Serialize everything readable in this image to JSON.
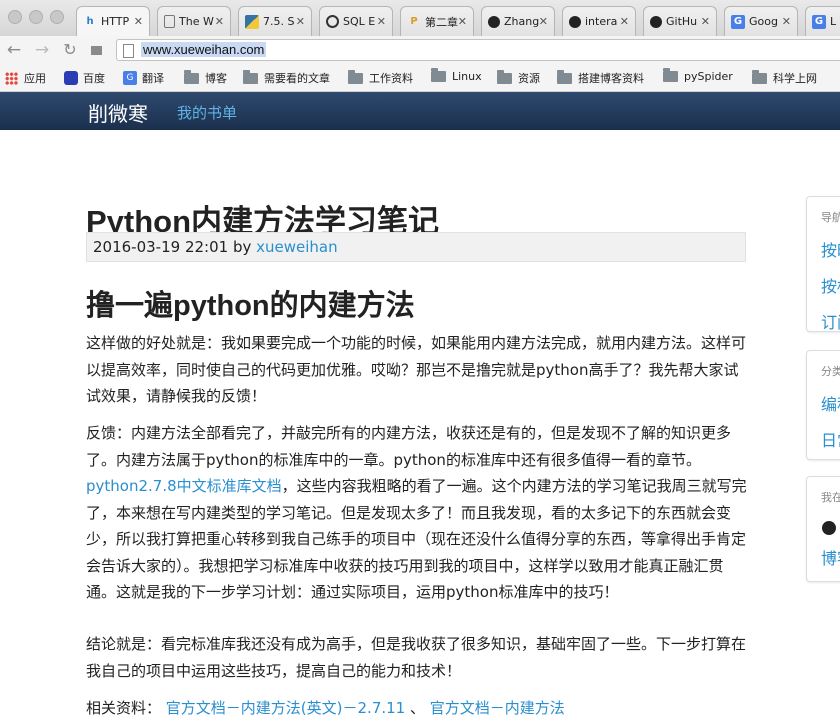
{
  "browser": {
    "tabs": [
      {
        "label": "HTTP",
        "icon": "hm-icon",
        "icon_color": "#2a7fd0"
      },
      {
        "label": "The W",
        "icon": "page-icon",
        "icon_color": "#666666"
      },
      {
        "label": "7.5. S",
        "icon": "python-icon",
        "icon_color": "#3572a5"
      },
      {
        "label": "SQL E",
        "icon": "sql-icon",
        "icon_color": "#333333"
      },
      {
        "label": "第二章",
        "icon": "p-icon",
        "icon_color": "#d6a11e"
      },
      {
        "label": "Zhang",
        "icon": "github-icon",
        "icon_color": "#222222"
      },
      {
        "label": "intera",
        "icon": "github-icon",
        "icon_color": "#222222"
      },
      {
        "label": "GitHu",
        "icon": "github-icon",
        "icon_color": "#222222"
      },
      {
        "label": "Goog",
        "icon": "google-translate-icon",
        "icon_color": "#4a7ee8"
      },
      {
        "label": "L",
        "icon": "google-translate-icon",
        "icon_color": "#4a7ee8"
      }
    ],
    "url": "www.xueweihan.com"
  },
  "bookmarks": [
    {
      "label": "应用",
      "icon": "apps-icon"
    },
    {
      "label": "百度",
      "icon": "baidu-icon"
    },
    {
      "label": "翻译",
      "icon": "translate-icon"
    },
    {
      "label": "博客",
      "icon": "folder-icon"
    },
    {
      "label": "需要看的文章",
      "icon": "folder-icon"
    },
    {
      "label": "工作资料",
      "icon": "folder-icon"
    },
    {
      "label": "Linux",
      "icon": "folder-icon"
    },
    {
      "label": "资源",
      "icon": "folder-icon"
    },
    {
      "label": "搭建博客资料",
      "icon": "folder-icon"
    },
    {
      "label": "pySpider",
      "icon": "folder-icon"
    },
    {
      "label": "科学上网",
      "icon": "folder-icon"
    }
  ],
  "site": {
    "brand": "削微寒",
    "nav_link": "我的书单"
  },
  "article": {
    "title": "Python内建方法学习笔记",
    "date": "2016-03-19 22:01",
    "by": "by",
    "author": "xueweihan",
    "heading": "撸一遍python的内建方法",
    "p1": "这样做的好处就是：我如果要完成一个功能的时候，如果能用内建方法完成，就用内建方法。这样可以提高效率，同时使自己的代码更加优雅。哎呦？那岂不是撸完就是python高手了？我先帮大家试试效果，请静候我的反馈！",
    "p2_before": "反馈：内建方法全部看完了，并敲完所有的内建方法，收获还是有的，但是发现不了解的知识更多了。内建方法属于python的标准库中的一章。python的标准库中还有很多值得一看的章节。",
    "p2_link": "python2.7.8中文标准库文档",
    "p2_after": "，这些内容我粗略的看了一遍。这个内建方法的学习笔记我周三就写完了，本来想在写内建类型的学习笔记。但是发现太多了！而且我发现，看的太多记下的东西就会变少，所以我打算把重心转移到我自己练手的项目中（现在还没什么值得分享的东西，等拿得出手肯定会告诉大家的）。我想把学习标准库中收获的技巧用到我的项目中，这样学以致用才能真正融汇贯通。这就是我的下一步学习计划：通过实际项目，运用python标准库中的技巧！",
    "p3": "结论就是：看完标准库我还没有成为高手，但是我收获了很多知识，基础牢固了一些。下一步打算在我自己的项目中运用这些技巧，提高自己的能力和技术！",
    "related_label": "相关资料：",
    "related_link1": "官方文档－内建方法(英文)－2.7.11",
    "related_sep": "、",
    "related_link2": "官方文档－内建方法"
  },
  "sidebar": {
    "panel1": {
      "head": "导航",
      "links": [
        "按时",
        "按标",
        "订阅"
      ]
    },
    "panel2": {
      "head": "分类",
      "links": [
        "编程",
        "日常"
      ]
    },
    "panel3": {
      "head": "我在",
      "links": [
        "博客"
      ]
    }
  }
}
